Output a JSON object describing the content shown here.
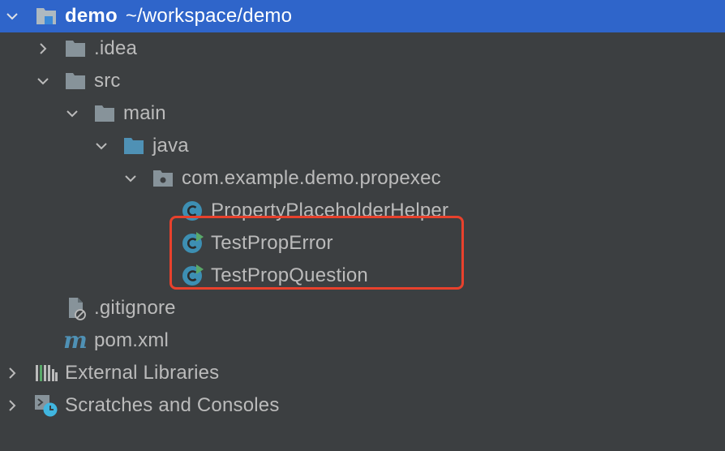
{
  "tree": {
    "root": {
      "name": "demo",
      "path": "~/workspace/demo"
    },
    "idea": "idea",
    "idea_dot": ".",
    "src": "src",
    "main": "main",
    "java": "java",
    "package": "com.example.demo.propexec",
    "classes": [
      "PropertyPlaceholderHelper",
      "TestPropError",
      "TestPropQuestion"
    ],
    "gitignore": ".gitignore",
    "pom": "pom.xml",
    "external_libraries": "External Libraries",
    "scratches": "Scratches and Consoles"
  },
  "colors": {
    "background": "#3c3f41",
    "selection": "#2f65ca",
    "folder": "#87939a",
    "source_folder": "#4f91b5",
    "class_icon": "#3d8fb3",
    "run_marker": "#59a869",
    "highlight": "#e8412c"
  },
  "icons": [
    "chevron-down-icon",
    "chevron-right-icon",
    "project-folder-icon",
    "folder-icon",
    "source-folder-icon",
    "package-icon",
    "class-icon",
    "runnable-class-icon",
    "ignored-file-icon",
    "maven-icon",
    "libraries-icon",
    "scratches-icon"
  ]
}
